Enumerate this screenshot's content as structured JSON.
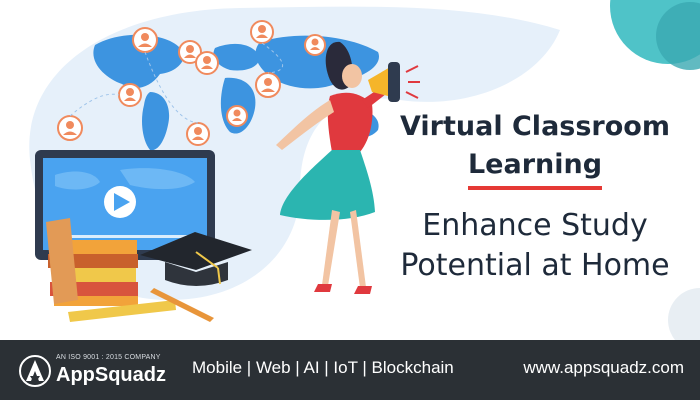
{
  "banner": {
    "title_line1": "Virtual Classroom",
    "title_line2": "Learning",
    "subtitle_line1": "Enhance Study",
    "subtitle_line2": "Potential at Home"
  },
  "footer": {
    "iso_text": "AN ISO 9001 : 2015 COMPANY",
    "brand": "AppSquadz",
    "services": "Mobile | Web | AI | IoT | Blockchain",
    "website": "www.appsquadz.com"
  },
  "colors": {
    "accent": "#e53935",
    "footer_bg": "#2b3035",
    "blob": "#e6f0fa",
    "teal": "#4fc3c8",
    "map": "#3d94e0",
    "dress": "#2bb5b0",
    "top": "#e0393e"
  },
  "icons": [
    "user-avatar-icon",
    "world-map",
    "megaphone-icon",
    "play-icon",
    "graduation-cap-icon",
    "books-icon",
    "pencil-icon",
    "ruler-icon",
    "appsquadz-logo-icon"
  ]
}
